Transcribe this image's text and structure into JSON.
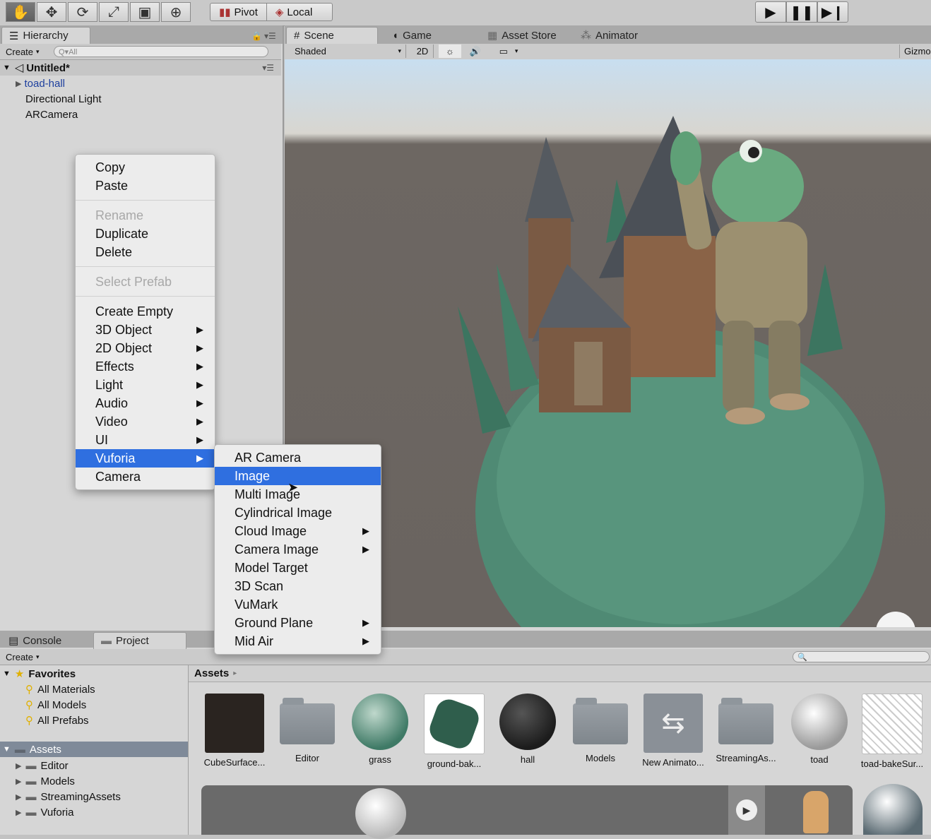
{
  "toolbar": {
    "tools": [
      "hand-icon",
      "move-icon",
      "rotate-icon",
      "scale-icon",
      "rect-icon",
      "transform-icon"
    ],
    "pivot_label": "Pivot",
    "local_label": "Local",
    "play": [
      "play-icon",
      "pause-icon",
      "step-icon"
    ]
  },
  "hierarchy": {
    "tab_label": "Hierarchy",
    "create_label": "Create",
    "search_placeholder": "Q▾All",
    "scene_name": "Untitled*",
    "items": [
      "toad-hall",
      "Directional Light",
      "ARCamera"
    ]
  },
  "scene_tabs": {
    "scene": "Scene",
    "game": "Game",
    "asset_store": "Asset Store",
    "animator": "Animator"
  },
  "scene_toolbar": {
    "shading": "Shaded",
    "mode_2d": "2D",
    "gizmos": "Gizmo"
  },
  "context_menu": {
    "items": [
      {
        "label": "Copy",
        "enabled": true
      },
      {
        "label": "Paste",
        "enabled": true
      },
      {
        "label": "Rename",
        "enabled": false
      },
      {
        "label": "Duplicate",
        "enabled": true
      },
      {
        "label": "Delete",
        "enabled": true
      },
      {
        "label": "Select Prefab",
        "enabled": false
      },
      {
        "label": "Create Empty",
        "enabled": true
      },
      {
        "label": "3D Object",
        "submenu": true
      },
      {
        "label": "2D Object",
        "submenu": true
      },
      {
        "label": "Effects",
        "submenu": true
      },
      {
        "label": "Light",
        "submenu": true
      },
      {
        "label": "Audio",
        "submenu": true
      },
      {
        "label": "Video",
        "submenu": true
      },
      {
        "label": "UI",
        "submenu": true
      },
      {
        "label": "Vuforia",
        "submenu": true,
        "highlighted": true
      },
      {
        "label": "Camera",
        "enabled": true
      }
    ]
  },
  "vuforia_menu": {
    "items": [
      {
        "label": "AR Camera"
      },
      {
        "label": "Image",
        "highlighted": true
      },
      {
        "label": "Multi Image"
      },
      {
        "label": "Cylindrical Image"
      },
      {
        "label": "Cloud Image",
        "submenu": true
      },
      {
        "label": "Camera Image",
        "submenu": true
      },
      {
        "label": "Model Target"
      },
      {
        "label": "3D Scan"
      },
      {
        "label": "VuMark"
      },
      {
        "label": "Ground Plane",
        "submenu": true
      },
      {
        "label": "Mid Air",
        "submenu": true
      }
    ]
  },
  "bottom_tabs": {
    "console": "Console",
    "project": "Project"
  },
  "project": {
    "create_label": "Create",
    "favorites_label": "Favorites",
    "favorites": [
      "All Materials",
      "All Models",
      "All Prefabs"
    ],
    "assets_label": "Assets",
    "folders": [
      "Editor",
      "Models",
      "StreamingAssets",
      "Vuforia"
    ],
    "breadcrumb": "Assets",
    "assets": [
      {
        "label": "CubeSurface...",
        "kind": "texture"
      },
      {
        "label": "Editor",
        "kind": "folder"
      },
      {
        "label": "grass",
        "kind": "material"
      },
      {
        "label": "ground-bak...",
        "kind": "texture"
      },
      {
        "label": "hall",
        "kind": "material"
      },
      {
        "label": "Models",
        "kind": "folder"
      },
      {
        "label": "New Animato...",
        "kind": "animator"
      },
      {
        "label": "StreamingAs...",
        "kind": "folder"
      },
      {
        "label": "toad",
        "kind": "material"
      },
      {
        "label": "toad-bakeSur...",
        "kind": "texture"
      }
    ]
  }
}
